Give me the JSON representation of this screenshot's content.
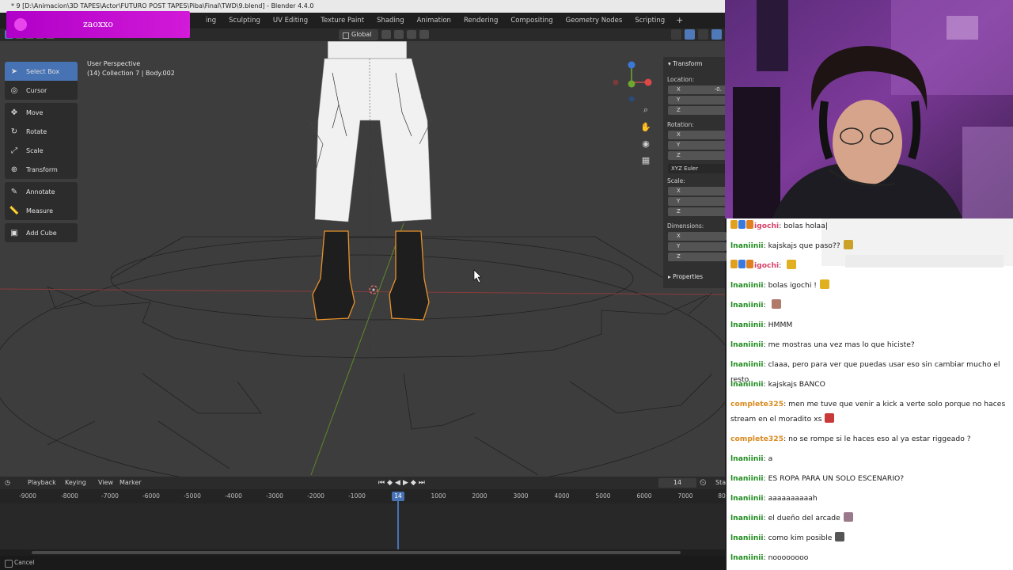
{
  "window": {
    "title": "* 9 [D:\\Animacion\\3D TAPES\\Actor\\FUTURO POST TAPES\\Piba\\Final\\TWD\\9.blend] - Blender 4.4.0"
  },
  "overlay": {
    "streamer_name": "zaoxxo"
  },
  "workspace_tabs": [
    "ing",
    "Sculpting",
    "UV Editing",
    "Texture Paint",
    "Shading",
    "Animation",
    "Rendering",
    "Compositing",
    "Geometry Nodes",
    "Scripting"
  ],
  "workspace_add": "+",
  "header": {
    "orientation": "Global"
  },
  "viewport": {
    "view_name": "User Perspective",
    "object_info": "(14) Collection 7 | Body.002"
  },
  "tools": [
    {
      "label": "Select Box",
      "icon": "select-box-icon",
      "active": true
    },
    {
      "label": "Cursor",
      "icon": "cursor-icon"
    },
    {
      "label": "Move",
      "icon": "move-icon"
    },
    {
      "label": "Rotate",
      "icon": "rotate-icon"
    },
    {
      "label": "Scale",
      "icon": "scale-icon"
    },
    {
      "label": "Transform",
      "icon": "transform-icon"
    },
    {
      "label": "Annotate",
      "icon": "annotate-icon"
    },
    {
      "label": "Measure",
      "icon": "measure-icon"
    },
    {
      "label": "Add Cube",
      "icon": "add-cube-icon"
    }
  ],
  "npanel": {
    "transform_title": "Transform",
    "location_label": "Location:",
    "location_x": "-0.",
    "rotation_label": "Rotation:",
    "rotation_mode": "XYZ Euler",
    "scale_label": "Scale:",
    "dimensions_label": "Dimensions:",
    "properties_title": "Properties",
    "axis_x": "X",
    "axis_y": "Y",
    "axis_z": "Z"
  },
  "timeline": {
    "playback": "Playback",
    "keying": "Keying",
    "view": "View",
    "marker": "Marker",
    "current_frame": "14",
    "start_label": "Sta",
    "ticks": [
      "-9000",
      "-8000",
      "-7000",
      "-6000",
      "-5000",
      "-4000",
      "-3000",
      "-2000",
      "-1000",
      "1000",
      "2000",
      "3000",
      "4000",
      "5000",
      "6000",
      "7000",
      "80"
    ]
  },
  "status": {
    "text": "Cancel"
  },
  "chat": {
    "messages": [
      {
        "user": "igochi",
        "text": "bolas holaa|",
        "color": "#d8436a",
        "badges": true
      },
      {
        "user": "lnaniinii",
        "text": "kajskajs que paso??",
        "color": "#1e8c1e",
        "emote": "#c9a227"
      },
      {
        "user": "igochi",
        "text": "",
        "color": "#d8436a",
        "badges": true,
        "emote": "#e0b020"
      },
      {
        "user": "lnaniinii",
        "text": "bolas igochi !",
        "color": "#1e8c1e",
        "emote": "#e0b020"
      },
      {
        "user": "lnaniinii",
        "text": "",
        "color": "#1e8c1e",
        "emote": "#b07a6a"
      },
      {
        "user": "lnaniinii",
        "text": "HMMM",
        "color": "#1e8c1e"
      },
      {
        "user": "lnaniinii",
        "text": "me mostras una vez mas lo que hiciste?",
        "color": "#1e8c1e"
      },
      {
        "user": "lnaniinii",
        "text": "claaa, pero para ver que puedas usar eso sin cambiar mucho el resto",
        "color": "#1e8c1e"
      },
      {
        "user": "lnaniinii",
        "text": "kajskajs BANCO",
        "color": "#1e8c1e"
      },
      {
        "user": "complete325",
        "text": "men me tuve que venir a kick a verte solo porque no haces stream en el moradito xs",
        "color": "#d88a1e",
        "emote": "#c83a3a",
        "two_line": true
      },
      {
        "user": "complete325",
        "text": "no se rompe si le haces eso al ya estar riggeado ?",
        "color": "#d88a1e"
      },
      {
        "user": "lnaniinii",
        "text": "a",
        "color": "#1e8c1e"
      },
      {
        "user": "lnaniinii",
        "text": "ES ROPA PARA UN SOLO ESCENARIO?",
        "color": "#1e8c1e"
      },
      {
        "user": "lnaniinii",
        "text": "aaaaaaaaaah",
        "color": "#1e8c1e"
      },
      {
        "user": "lnaniinii",
        "text": "el dueño del arcade",
        "color": "#1e8c1e",
        "emote": "#9a7a8a"
      },
      {
        "user": "lnaniinii",
        "text": "como kim posible",
        "color": "#1e8c1e",
        "emote": "#555555"
      },
      {
        "user": "lnaniinii",
        "text": "noooooooo",
        "color": "#1e8c1e"
      }
    ]
  },
  "colors": {
    "accent": "#4772b3",
    "selection_outline": "#e8922a",
    "overlay_magenta": "#c00ed0"
  }
}
